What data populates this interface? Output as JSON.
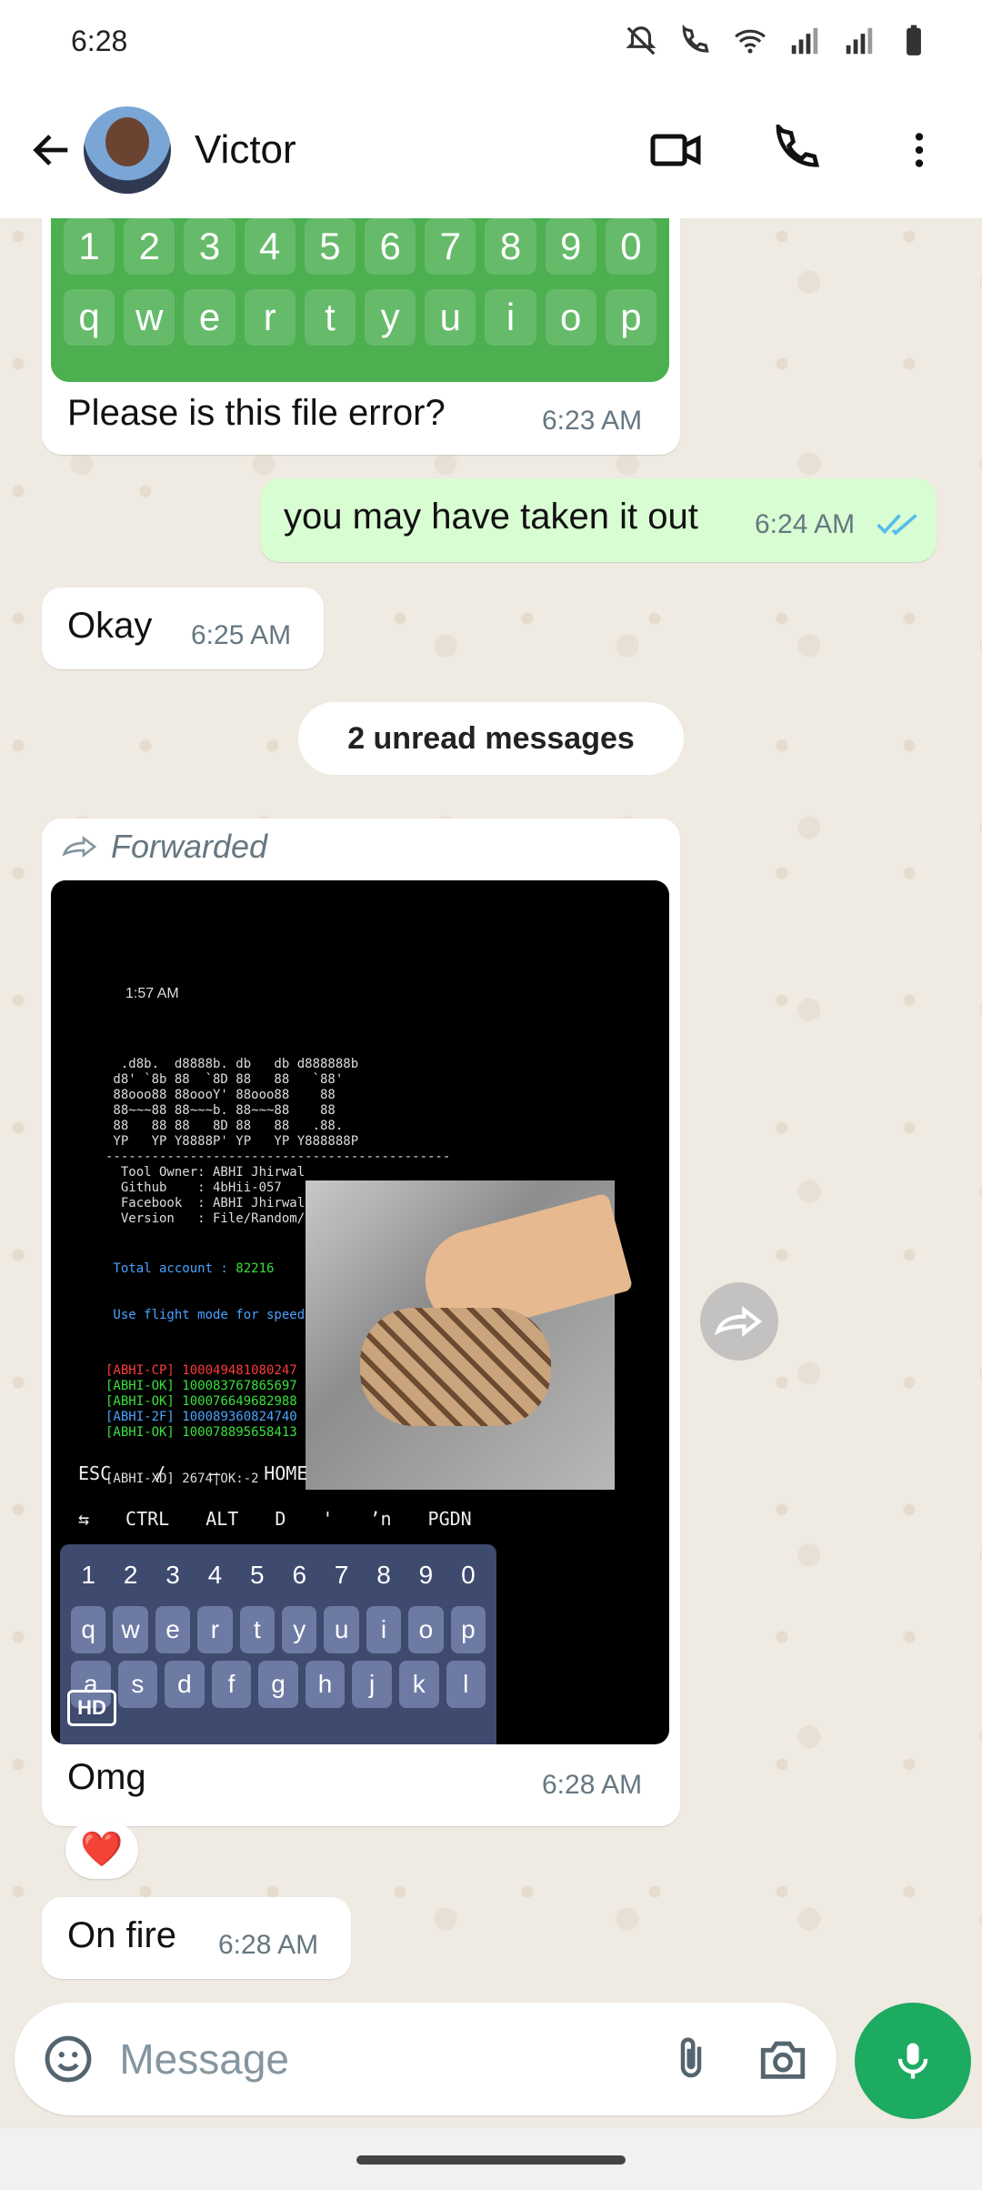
{
  "status_bar": {
    "time": "6:28"
  },
  "header": {
    "contact_name": "Victor"
  },
  "chat": {
    "keyboard_image_rows": [
      [
        "1",
        "2",
        "3",
        "4",
        "5",
        "6",
        "7",
        "8",
        "9",
        "0"
      ],
      [
        "q",
        "w",
        "e",
        "r",
        "t",
        "y",
        "u",
        "i",
        "o",
        "p"
      ]
    ],
    "messages": [
      {
        "direction": "in",
        "text": "Please is this file error?",
        "time": "6:23 AM"
      },
      {
        "direction": "out",
        "text": "you may have taken it out",
        "time": "6:24 AM",
        "read": true
      },
      {
        "direction": "in",
        "text": "Okay",
        "time": "6:25 AM"
      },
      {
        "direction": "in",
        "forwarded_label": "Forwarded",
        "text": "Omg",
        "time": "6:28 AM",
        "hd_label": "HD",
        "reaction": "❤️"
      },
      {
        "direction": "in",
        "text": "On fire",
        "time": "6:28 AM"
      }
    ],
    "unread_divider": "2 unread messages",
    "media_screenshot": {
      "status_time": "1:57 AM",
      "terminal_lines": [
        "  .d8b.  d8888b. db   db d888888b",
        " d8' `8b 88  `8D 88   88   `88'",
        " 88ooo88 88oooY' 88ooo88    88",
        " 88~~~88 88~~~b. 88~~~88    88",
        " 88   88 88   8D 88   88   .88.",
        " YP   YP Y8888P' YP   YP Y888888P",
        "---------------------------------------------",
        "  Tool Owner: ABHI Jhirwal",
        "  Github    : 4bHii-057",
        "  Facebook  : ABHI Jhirwal",
        "  Version   : File/Random/O."
      ],
      "total_account_label": " Total account : ",
      "total_account_value": "82216",
      "flight_mode": " Use flight mode for speed",
      "results": [
        {
          "tag": "[ABHI-CP]",
          "id": "100049481080247"
        },
        {
          "tag": "[ABHI-OK]",
          "id": "100083767865697"
        },
        {
          "tag": "[ABHI-OK]",
          "id": "100076649682988"
        },
        {
          "tag": "[ABHI-2F]",
          "id": "100089360824740"
        },
        {
          "tag": "[ABHI-OK]",
          "id": "100078895658413"
        }
      ],
      "progress_line": "[ABHI-XD] 2674|OK:-2",
      "extra_keys_row1": [
        "ESC",
        "/",
        "—",
        "HOME"
      ],
      "extra_keys_row2": [
        "⇆",
        "CTRL",
        "ALT",
        "D",
        "'",
        "ʼn",
        "PGDN"
      ],
      "kb_numbers": [
        "1",
        "2",
        "3",
        "4",
        "5",
        "6",
        "7",
        "8",
        "9",
        "0"
      ],
      "kb_row1": [
        "q",
        "w",
        "e",
        "r",
        "t",
        "y",
        "u",
        "i",
        "o",
        "p"
      ],
      "kb_row2": [
        "a",
        "s",
        "d",
        "f",
        "g",
        "h",
        "j",
        "k",
        "l"
      ]
    }
  },
  "input": {
    "placeholder": "Message"
  },
  "colors": {
    "accent": "#1daa61",
    "outgoing_bubble": "#d9fdd3",
    "read_tick": "#53bdeb",
    "chat_bg": "#efeae2"
  }
}
